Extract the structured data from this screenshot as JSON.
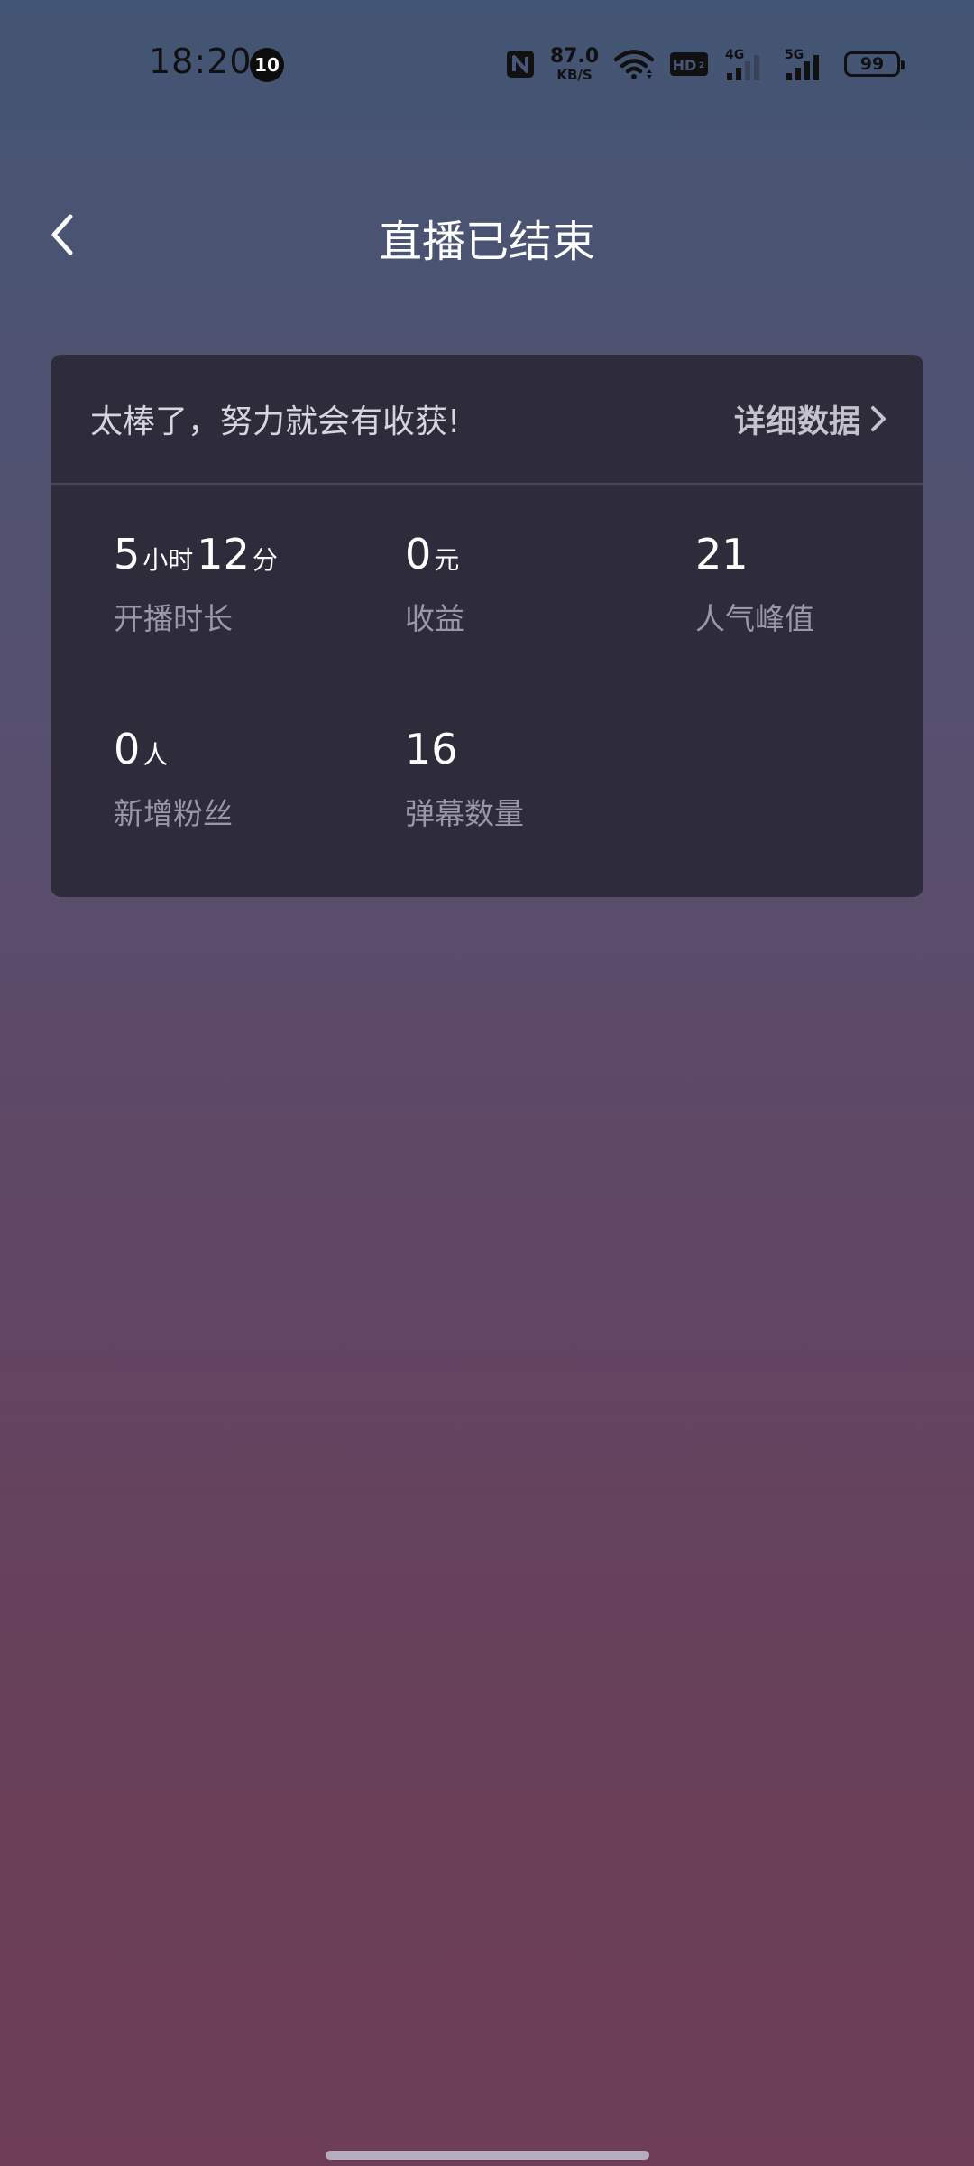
{
  "status_bar": {
    "time": "18:20",
    "notification_count": "10",
    "net_speed_value": "87.0",
    "net_speed_unit": "KB/S",
    "hd_label": "HD",
    "sig1_label": "4G",
    "sig2_label": "5G",
    "battery": "99"
  },
  "header": {
    "title": "直播已结束"
  },
  "card": {
    "message": "太棒了，努力就会有收获!",
    "detail_label": "详细数据",
    "stats": [
      {
        "parts": [
          {
            "num": "5",
            "unit": "小时"
          },
          {
            "num": "12",
            "unit": "分"
          }
        ],
        "label": "开播时长"
      },
      {
        "parts": [
          {
            "num": "0",
            "unit": "元"
          }
        ],
        "label": "收益"
      },
      {
        "parts": [
          {
            "num": "21",
            "unit": ""
          }
        ],
        "label": "人气峰值"
      },
      {
        "parts": [
          {
            "num": "0",
            "unit": "人"
          }
        ],
        "label": "新增粉丝"
      },
      {
        "parts": [
          {
            "num": "16",
            "unit": ""
          }
        ],
        "label": "弹幕数量"
      }
    ]
  },
  "colors": {
    "card_bg": "#2e2c3b",
    "label_gray": "#9a98a6",
    "title_white": "#ffffff"
  },
  "icons": {
    "back": "chevron-left-icon",
    "detail": "chevron-right-icon",
    "nfc": "nfc-icon",
    "wifi": "wifi-icon",
    "signal": "signal-icon",
    "battery": "battery-icon"
  }
}
